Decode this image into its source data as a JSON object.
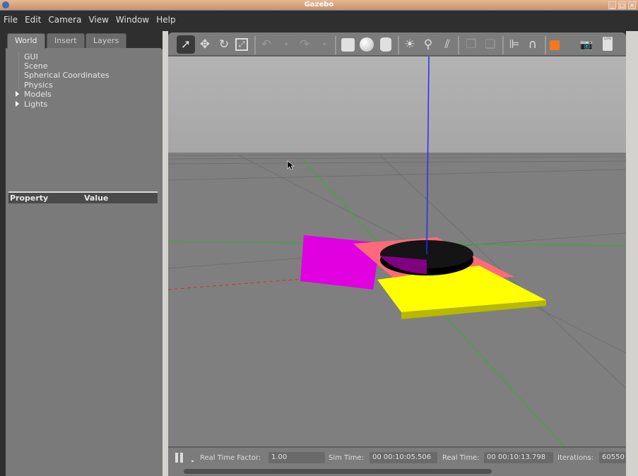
{
  "window": {
    "title": "Gazebo"
  },
  "menu": [
    "File",
    "Edit",
    "Camera",
    "View",
    "Window",
    "Help"
  ],
  "left_panel": {
    "tabs": [
      "World",
      "Insert",
      "Layers"
    ],
    "tree": [
      "GUI",
      "Scene",
      "Spherical Coordinates",
      "Physics",
      "Models",
      "Lights"
    ],
    "property_header": {
      "property": "Property",
      "value": "Value"
    }
  },
  "toolbar": {
    "icons": [
      "select-arrow-icon",
      "translate-icon",
      "rotate-icon",
      "scale-icon",
      "undo-icon",
      "undo-dropdown-icon",
      "redo-icon",
      "redo-dropdown-icon",
      "box-icon",
      "sphere-icon",
      "cylinder-icon",
      "point-light-icon",
      "spot-light-icon",
      "directional-light-icon",
      "copy-icon",
      "paste-icon",
      "align-icon",
      "snap-icon",
      "view-angle-icon",
      "screenshot-icon",
      "log-icon"
    ]
  },
  "bottom_bar": {
    "rtf_label": "Real Time Factor:",
    "rtf_value": "1.00",
    "sim_label": "Sim Time:",
    "sim_value": "00 00:10:05.506",
    "real_label": "Real Time:",
    "real_value": "00 00:10:13.798",
    "iter_label": "Iterations:",
    "iter_value": "60550"
  },
  "colors": {
    "accent": "#f07820",
    "magenta": "#e000e0",
    "yellow": "#ffff00",
    "pink": "#ff6a7a"
  }
}
